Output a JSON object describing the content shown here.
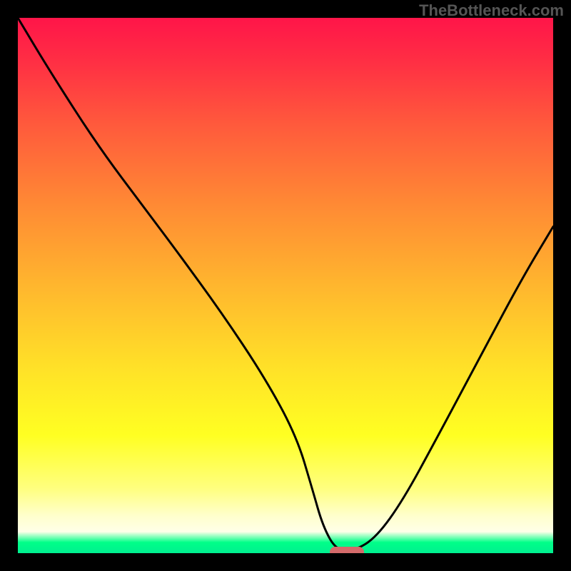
{
  "attribution": "TheBottleneck.com",
  "chart_data": {
    "type": "line",
    "title": "",
    "xlabel": "",
    "ylabel": "",
    "xlim": [
      0,
      100
    ],
    "ylim": [
      0,
      100
    ],
    "x": [
      0,
      6,
      15,
      24,
      30,
      38,
      46,
      52,
      55,
      57,
      59.5,
      63,
      67,
      72,
      78,
      86,
      94,
      100
    ],
    "values": [
      100,
      90,
      76,
      64,
      56,
      45,
      33,
      22,
      12,
      5,
      0.5,
      0.5,
      3,
      10,
      21,
      36,
      51,
      61
    ],
    "marker_x": 61.5,
    "gradient_stops": [
      {
        "pos": 0,
        "color": "#ff1549"
      },
      {
        "pos": 8,
        "color": "#ff2e44"
      },
      {
        "pos": 20,
        "color": "#ff5a3c"
      },
      {
        "pos": 35,
        "color": "#ff8a34"
      },
      {
        "pos": 50,
        "color": "#ffb62e"
      },
      {
        "pos": 65,
        "color": "#ffe028"
      },
      {
        "pos": 78,
        "color": "#ffff22"
      },
      {
        "pos": 88,
        "color": "#ffff80"
      },
      {
        "pos": 93,
        "color": "#ffffcc"
      },
      {
        "pos": 96,
        "color": "#ffffe8"
      },
      {
        "pos": 98,
        "color": "#00ff88"
      },
      {
        "pos": 100,
        "color": "#00f090"
      }
    ]
  }
}
